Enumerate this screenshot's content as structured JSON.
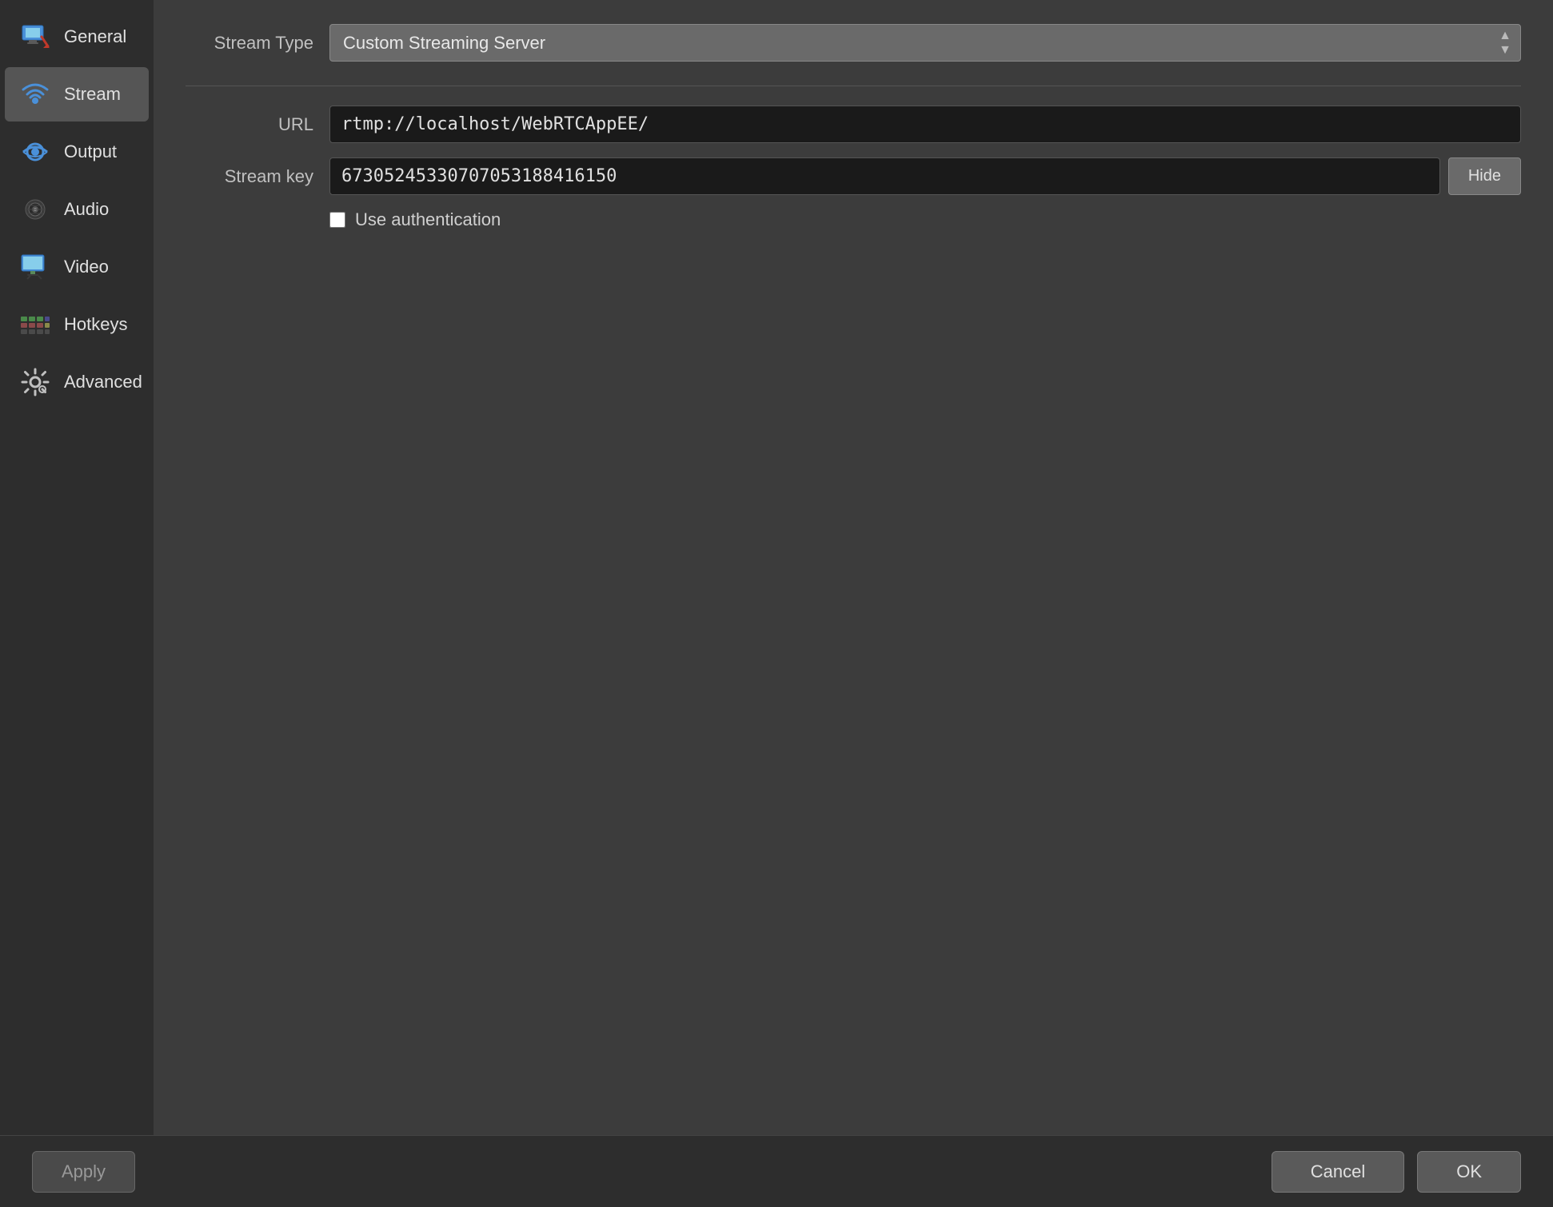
{
  "sidebar": {
    "items": [
      {
        "id": "general",
        "label": "General",
        "active": false
      },
      {
        "id": "stream",
        "label": "Stream",
        "active": true
      },
      {
        "id": "output",
        "label": "Output",
        "active": false
      },
      {
        "id": "audio",
        "label": "Audio",
        "active": false
      },
      {
        "id": "video",
        "label": "Video",
        "active": false
      },
      {
        "id": "hotkeys",
        "label": "Hotkeys",
        "active": false
      },
      {
        "id": "advanced",
        "label": "Advanced",
        "active": false
      }
    ]
  },
  "content": {
    "stream_type_label": "Stream Type",
    "stream_type_value": "Custom Streaming Server",
    "url_label": "URL",
    "url_value": "rtmp://localhost/WebRTCAppEE/",
    "stream_key_label": "Stream key",
    "stream_key_value": "67305245330707053188416150",
    "hide_button_label": "Hide",
    "use_auth_label": "Use authentication"
  },
  "footer": {
    "apply_label": "Apply",
    "cancel_label": "Cancel",
    "ok_label": "OK"
  }
}
